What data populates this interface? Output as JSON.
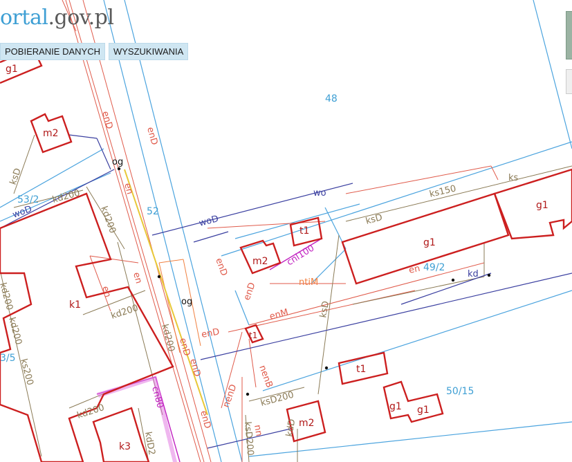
{
  "header": {
    "logo_part1": "ortal",
    "logo_part2": ".gov.pl",
    "nav": [
      {
        "label": "POBIERANIE DANYCH"
      },
      {
        "label": "WYSZUKIWANIA"
      }
    ]
  },
  "colors": {
    "building": "#cc1f1f",
    "parcel": "#4aa3de",
    "electric": "#e05a4a",
    "sewer": "#8a7a55",
    "water": "#3a3fa0",
    "telecom": "#c020c0",
    "gas": "#e8c838",
    "heat": "#f08040"
  },
  "map": {
    "parcels": [
      "48",
      "53/2",
      "52",
      "49/2",
      "50/15",
      "3/5"
    ],
    "buildings": [
      "g1",
      "m2",
      "k1",
      "t1",
      "m2",
      "g1",
      "g1",
      "t1",
      "t1",
      "g1",
      "g1",
      "m2",
      "k3"
    ],
    "utilities": [
      "enD",
      "enD",
      "og",
      "woD",
      "wo",
      "woD",
      "kd200",
      "kd200",
      "kd200",
      "kd200",
      "kd200",
      "ksD",
      "ks",
      "ks150",
      "ksD",
      "cnl100",
      "ntiM",
      "en",
      "en",
      "en",
      "og",
      "enM",
      "enD",
      "enD",
      "enD",
      "ksD",
      "ksD200",
      "nenD",
      "nenB",
      "cn80",
      "enD",
      "enD",
      "enD",
      "ksD200",
      "kdD2",
      "nn",
      "kdD",
      "en",
      "kd",
      "kd200",
      "ks200",
      "kd200"
    ]
  }
}
